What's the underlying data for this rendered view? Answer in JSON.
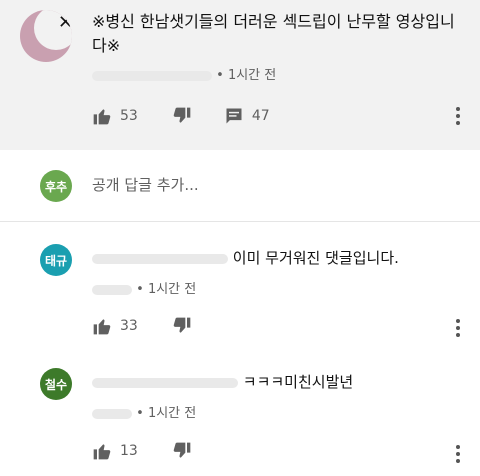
{
  "top_comment": {
    "text": "※병신 한남샛기들의 더러운 섹드립이 난무할 영상입니다※",
    "time": "• 1시간 전",
    "likes": "53",
    "replies": "47"
  },
  "reply_box": {
    "avatar_text": "후추",
    "avatar_color": "#6aa84f",
    "placeholder": "공개 답글 추가..."
  },
  "replies": [
    {
      "avatar_text": "태규",
      "avatar_color": "#1a9fb0",
      "text": "이미 무거워진 댓글입니다.",
      "time": "• 1시간 전",
      "likes": "33"
    },
    {
      "avatar_text": "철수",
      "avatar_color": "#3d7a2a",
      "text": "ㅋㅋㅋ미친시발년",
      "time": "• 1시간 전",
      "likes": "13"
    }
  ]
}
